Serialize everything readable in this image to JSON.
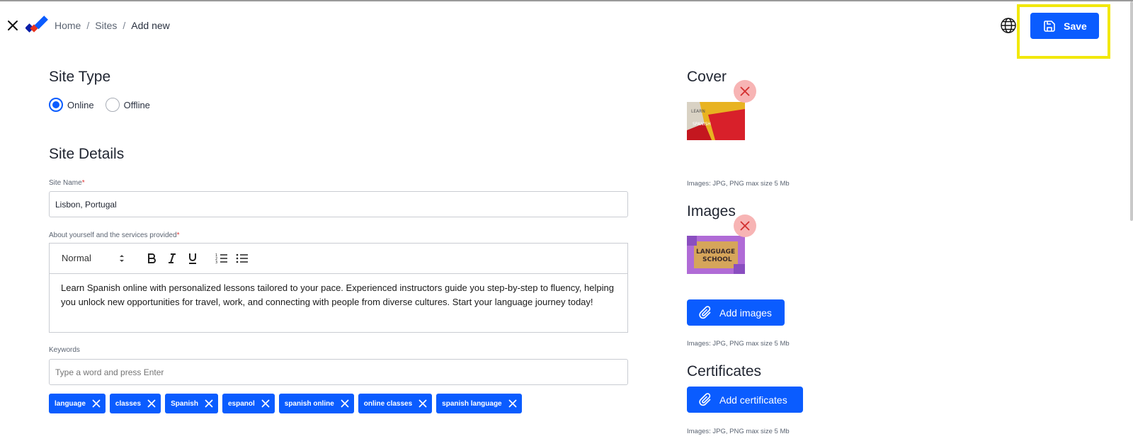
{
  "header": {
    "breadcrumb": [
      "Home",
      "Sites",
      "Add new"
    ],
    "save_label": "Save"
  },
  "site_type": {
    "title": "Site Type",
    "options": [
      {
        "label": "Online",
        "checked": true
      },
      {
        "label": "Offline",
        "checked": false
      }
    ]
  },
  "site_details": {
    "title": "Site Details",
    "site_name": {
      "label": "Site Name",
      "required_mark": "*",
      "value": "Lisbon, Portugal"
    },
    "about": {
      "label": "About yourself and the services provided",
      "required_mark": "*",
      "format_select": "Normal",
      "text": "Learn Spanish online with personalized lessons tailored to your pace. Experienced instructors guide you step-by-step to fluency, helping you unlock new opportunities for travel, work, and connecting with people from diverse cultures. Start your language journey today!"
    },
    "keywords": {
      "label": "Keywords",
      "placeholder": "Type a word and press Enter",
      "tags": [
        "language",
        "classes",
        "Spanish",
        "espanol",
        "spanish online",
        "online classes",
        "spanish language"
      ]
    }
  },
  "cover": {
    "title": "Cover",
    "hint": "Images: JPG, PNG max size 5 Mb",
    "thumb_text": [
      "LEARN",
      "SPANISH"
    ]
  },
  "images": {
    "title": "Images",
    "hint": "Images: JPG, PNG max size 5 Mb",
    "add_label": "Add images",
    "thumb_text": [
      "LANGUAGE",
      "SCHOOL"
    ]
  },
  "certificates": {
    "title": "Certificates",
    "hint": "Images: JPG, PNG max size 5 Mb",
    "add_label": "Add certificates"
  },
  "colors": {
    "primary": "#0a5cff",
    "highlight": "#f2e80a",
    "remove_bg": "#f7b4b4",
    "remove_x": "#d32f2f"
  }
}
